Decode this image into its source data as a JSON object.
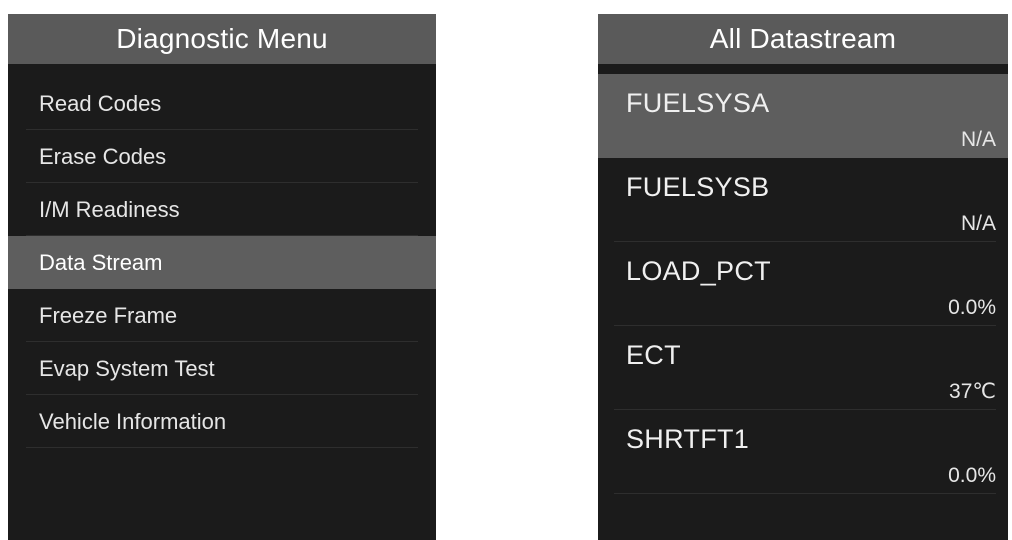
{
  "diagnostic_menu": {
    "title": "Diagnostic Menu",
    "items": [
      {
        "label": "Read Codes",
        "selected": false
      },
      {
        "label": "Erase Codes",
        "selected": false
      },
      {
        "label": "I/M Readiness",
        "selected": false
      },
      {
        "label": "Data Stream",
        "selected": true
      },
      {
        "label": "Freeze Frame",
        "selected": false
      },
      {
        "label": "Evap System Test",
        "selected": false
      },
      {
        "label": "Vehicle Information",
        "selected": false
      }
    ]
  },
  "all_datastream": {
    "title": "All Datastream",
    "rows": [
      {
        "name": "FUELSYSA",
        "value": "N/A",
        "selected": true
      },
      {
        "name": "FUELSYSB",
        "value": "N/A",
        "selected": false
      },
      {
        "name": "LOAD_PCT",
        "value": "0.0%",
        "selected": false
      },
      {
        "name": "ECT",
        "value": "37℃",
        "selected": false
      },
      {
        "name": "SHRTFT1",
        "value": "0.0%",
        "selected": false
      }
    ]
  },
  "colors": {
    "screen_bg": "#1b1b1b",
    "title_bar": "#5a5a5a",
    "highlight": "#5e5e5e",
    "text": "#e6e6e6"
  }
}
